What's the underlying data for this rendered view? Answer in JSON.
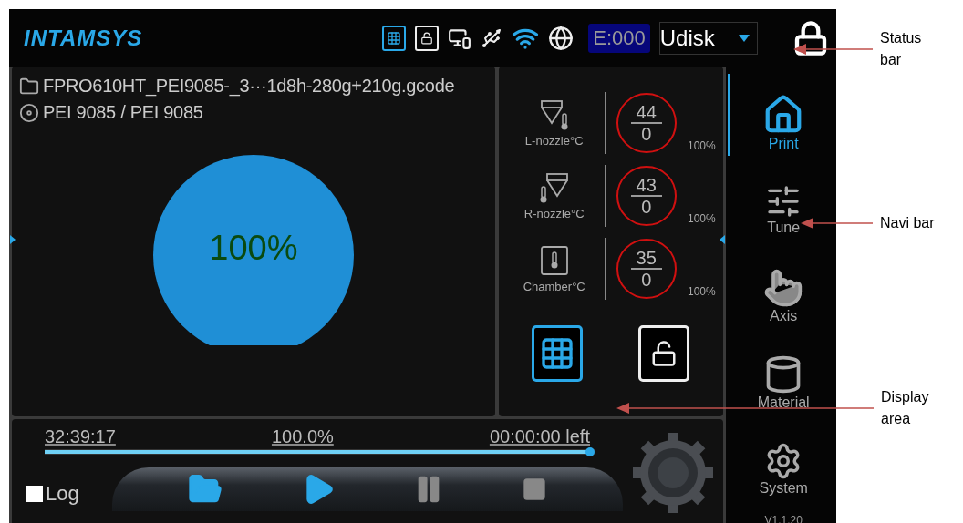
{
  "status_bar": {
    "logo": "INTAMSYS",
    "icons": [
      {
        "kind": "light",
        "on": true
      },
      {
        "kind": "door",
        "on": false
      },
      {
        "kind": "ethernet",
        "on": false
      },
      {
        "kind": "usb",
        "on": false
      },
      {
        "kind": "wifi",
        "on": true
      },
      {
        "kind": "globe",
        "on": false
      }
    ],
    "error_code": "E:000",
    "storage": "Udisk"
  },
  "file": {
    "name": "FPRO610HT_PEI9085-_3···1d8h-280g+210g.gcode",
    "material": "PEI 9085 / PEI 9085"
  },
  "progress_circle": {
    "label": "100%"
  },
  "temperatures": [
    {
      "kind": "left_nozzle",
      "label": "L-nozzle°C",
      "current": "44",
      "target": "0",
      "percent": "100%"
    },
    {
      "kind": "right_nozzle",
      "label": "R-nozzle°C",
      "current": "43",
      "target": "0",
      "percent": "100%"
    },
    {
      "kind": "chamber",
      "label": "Chamber°C",
      "current": "35",
      "target": "0",
      "percent": "100%"
    }
  ],
  "display_buttons": [
    {
      "kind": "light",
      "on": true
    },
    {
      "kind": "door",
      "on": false
    }
  ],
  "progress": {
    "elapsed": "32:39:17",
    "percent": "100.0%",
    "remaining": "00:00:00 left",
    "level": 1
  },
  "log": {
    "label": "Log",
    "checked": false
  },
  "media_buttons": [
    {
      "kind": "open",
      "disabled": false
    },
    {
      "kind": "play",
      "disabled": false
    },
    {
      "kind": "pause",
      "disabled": true
    },
    {
      "kind": "stop",
      "disabled": true
    }
  ],
  "nav": {
    "items": [
      {
        "kind": "print",
        "label": "Print",
        "selected": true
      },
      {
        "kind": "tune",
        "label": "Tune",
        "selected": false
      },
      {
        "kind": "axis",
        "label": "Axis",
        "selected": false
      },
      {
        "kind": "material",
        "label": "Material",
        "selected": false
      },
      {
        "kind": "system",
        "label": "System",
        "selected": false
      }
    ],
    "version": "V1.1.20"
  },
  "annotations": [
    {
      "kind": "status",
      "text": "Status bar"
    },
    {
      "kind": "navi",
      "text": "Navi bar"
    },
    {
      "kind": "display",
      "text": "Display area"
    }
  ]
}
